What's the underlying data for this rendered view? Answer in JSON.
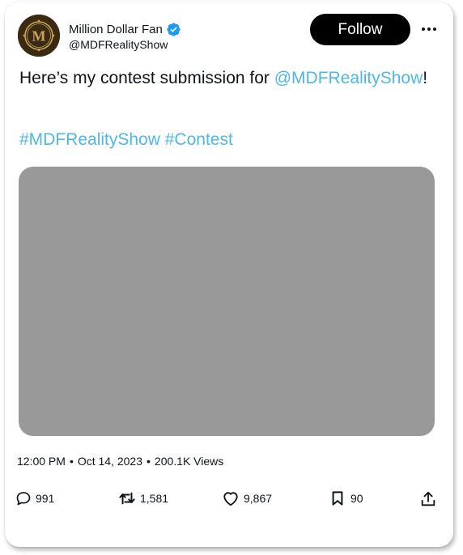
{
  "author": {
    "name": "Million Dollar Fan",
    "handle": "@MDFRealityShow",
    "avatar_letter": "M",
    "avatar_bg": "#3b2a12",
    "avatar_gold": "#c9a45c",
    "verified_color": "#1d9bf0"
  },
  "follow_label": "Follow",
  "tweet": {
    "text_prefix": "Here’s my contest submission for ",
    "mention": "@MDFRealityShow",
    "text_suffix": "!",
    "hashtags": [
      "#MDFRealityShow",
      "#Contest"
    ],
    "link_color": "#4db8e8"
  },
  "media": {
    "placeholder_color": "#999999"
  },
  "meta": {
    "time": "12:00 PM",
    "separator": "•",
    "date": "Oct 14, 2023",
    "views": "200.1K Views"
  },
  "actions": {
    "replies": {
      "icon": "reply-icon",
      "count": "991"
    },
    "retweets": {
      "icon": "retweet-icon",
      "count": "1,581"
    },
    "likes": {
      "icon": "heart-icon",
      "count": "9,867"
    },
    "bookmarks": {
      "icon": "bookmark-icon",
      "count": "90"
    },
    "share": {
      "icon": "share-icon"
    }
  }
}
